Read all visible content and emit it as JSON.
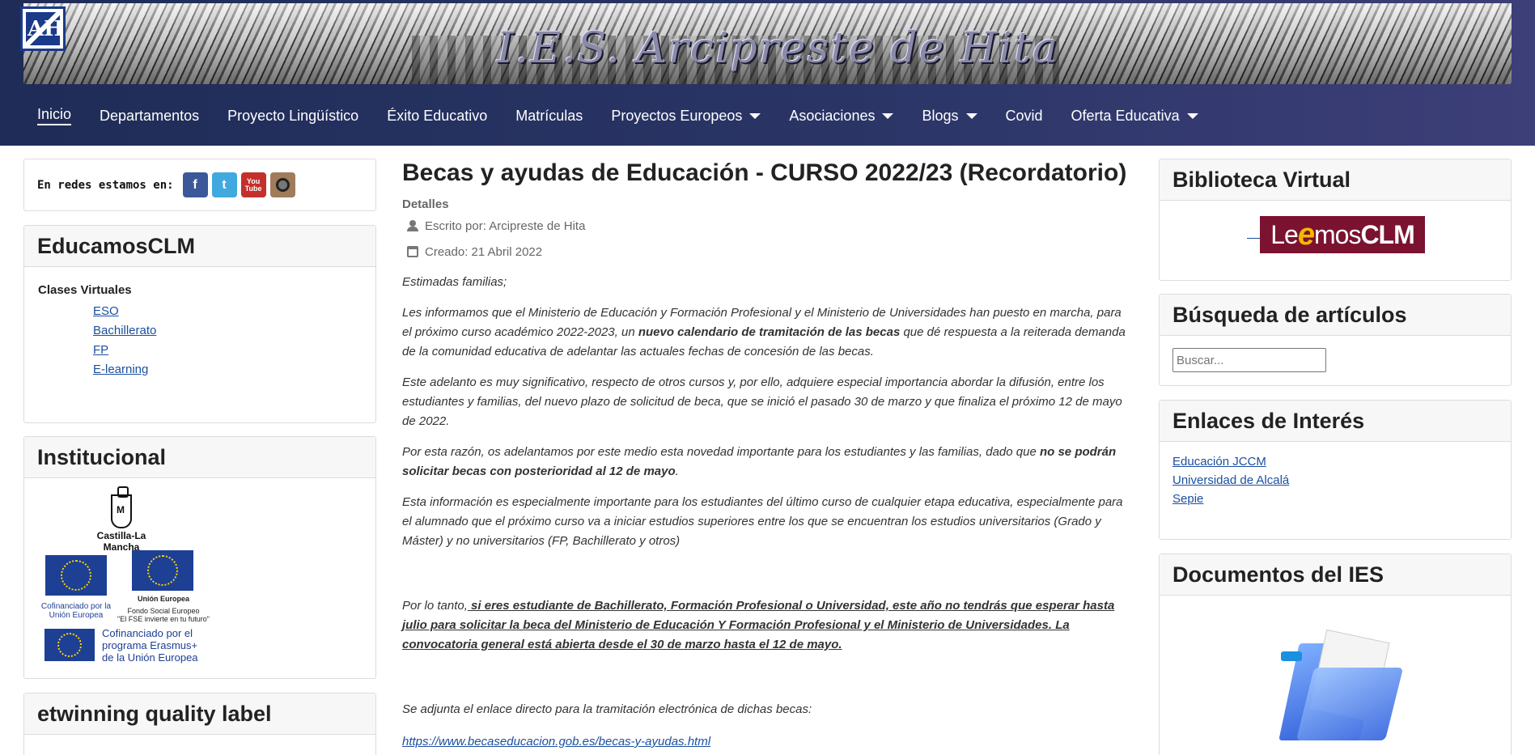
{
  "header": {
    "banner_title": "I.E.S. Arcipreste de Hita",
    "logo_text": "AH"
  },
  "nav": {
    "items": [
      {
        "label": "Inicio"
      },
      {
        "label": "Departamentos"
      },
      {
        "label": "Proyecto Lingüístico"
      },
      {
        "label": "Éxito Educativo"
      },
      {
        "label": "Matrículas"
      },
      {
        "label": "Proyectos Europeos"
      },
      {
        "label": "Asociaciones"
      },
      {
        "label": "Blogs"
      },
      {
        "label": "Covid"
      },
      {
        "label": "Oferta Educativa"
      }
    ]
  },
  "social": {
    "label": "En redes estamos en:",
    "icons": [
      "facebook-icon",
      "twitter-icon",
      "youtube-icon",
      "instagram-icon"
    ],
    "fb": "f",
    "tw": "t",
    "yt_top": "You",
    "yt_bottom": "Tube"
  },
  "educamos": {
    "title": "EducamosCLM",
    "subtitle": "Clases Virtuales",
    "links": [
      "ESO",
      "Bachillerato",
      "FP",
      "E-learning"
    ]
  },
  "institucional": {
    "title": "Institucional",
    "clm_name": "Castilla-La Mancha",
    "cofin1": "Cofinanciado por la Unión Europea",
    "ue": "Unión Europea",
    "fse1": "Fondo Social Europeo",
    "fse2": "\"El FSE invierte en tu futuro\"",
    "erasmus": "Cofinanciado por el programa Erasmus+ de la Unión Europea"
  },
  "etwinning": {
    "title": "etwinning quality label"
  },
  "article": {
    "title": "Becas y ayudas de Educación - CURSO 2022/23 (Recordatorio)",
    "details_label": "Detalles",
    "author": "Escrito por: Arcipreste de Hita",
    "created": "Creado: 21 Abril 2022",
    "p1": "Estimadas familias;",
    "p2a": " Les informamos que el Ministerio de Educación y Formación Profesional y el Ministerio de Universidades han puesto en marcha, para el próximo curso académico 2022-2023, un ",
    "p2b": "nuevo calendario de tramitación de las becas",
    "p2c": " que dé respuesta a la reiterada demanda de la comunidad educativa de adelantar las actuales fechas de concesión de las becas.",
    "p3": " Este adelanto es muy significativo, respecto de otros cursos y, por ello, adquiere especial importancia abordar la difusión, entre los estudiantes y familias, del nuevo plazo de solicitud de beca, que se inició el pasado 30 de marzo y que finaliza el próximo 12 de mayo de 2022.",
    "p4a": "Por esta razón, os adelantamos por este medio esta novedad importante para los estudiantes y las familias, dado que ",
    "p4b": "no se podrán solicitar becas con posterioridad al 12 de mayo",
    "p4c": ".",
    "p5": "Esta información es especialmente importante para los estudiantes del último curso de cualquier etapa educativa, especialmente para el alumnado que el próximo curso va a iniciar estudios superiores entre los que se encuentran los estudios universitarios (Grado y Máster) y no universitarios (FP, Bachillerato y otros)",
    "p6a": "Por lo tanto,",
    "p6b": " si eres estudiante de Bachillerato, Formación Profesional o Universidad, este año no tendrás que esperar hasta julio para solicitar la beca del Ministerio de Educación Y Formación Profesional y el Ministerio de Universidades.  La convocatoria general está abierta desde el 30 de marzo hasta el 12 de mayo.",
    "p7": "Se adjunta el enlace directo para la tramitación electrónica de dichas becas:",
    "link": "https://www.becaseducacion.gob.es/becas-y-ayudas.html"
  },
  "right": {
    "biblio_title": "Biblioteca Virtual",
    "leemos_le": "Le",
    "leemos_e": "e",
    "leemos_mos": "mos",
    "leemos_clm": "CLM",
    "search_title": "Búsqueda de artículos",
    "search_placeholder": "Buscar...",
    "enlaces_title": "Enlaces de Interés",
    "enlaces": [
      "Educación JCCM",
      "Universidad de Alcalá",
      "Sepie"
    ],
    "docs_title": "Documentos del IES"
  }
}
